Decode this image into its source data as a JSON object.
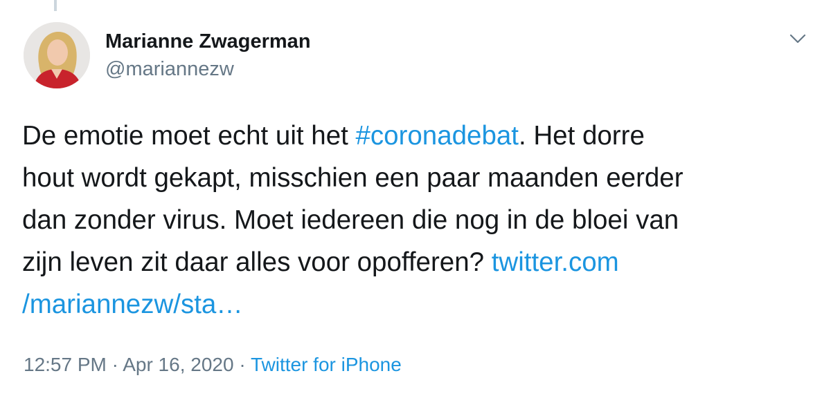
{
  "author": {
    "name": "Marianne Zwagerman",
    "handle": "@mariannezw"
  },
  "tweet": {
    "lines": [
      {
        "before": "De emotie moet echt uit het ",
        "hashtag": "#coronadebat",
        "after": ". Het dorre"
      },
      {
        "text": "hout wordt gekapt, misschien een paar maanden eerder"
      },
      {
        "text": "dan zonder virus. Moet iedereen die nog in de bloei van"
      },
      {
        "before": "zijn leven zit daar alles voor opofferen? ",
        "link_start": "twitter.com"
      },
      {
        "link_end": "/mariannezw/sta…"
      }
    ]
  },
  "meta": {
    "time": "12:57 PM",
    "separator1": " · ",
    "date": "Apr 16, 2020",
    "separator2": " · ",
    "source": "Twitter for iPhone"
  },
  "icons": {
    "caret": "chevron-down-icon",
    "avatar": "avatar"
  },
  "colors": {
    "link": "#1b95e0",
    "secondary": "#657786",
    "text": "#14171a"
  }
}
